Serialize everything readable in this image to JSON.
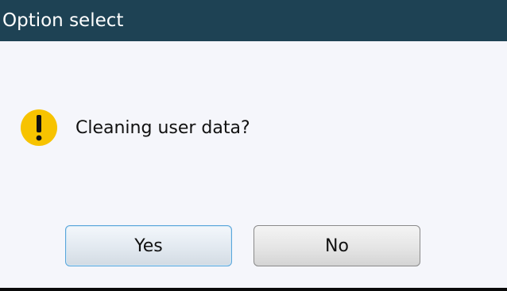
{
  "dialog": {
    "title": "Option select",
    "message": "Cleaning user data?",
    "icon": "warning-icon",
    "buttons": {
      "yes_label": "Yes",
      "no_label": "No"
    }
  },
  "colors": {
    "titlebar": "#1e4254",
    "title_text": "#ffffff",
    "background": "#f5f6fb",
    "warning_icon": "#f7c300",
    "focus_border": "#5aa6da"
  }
}
